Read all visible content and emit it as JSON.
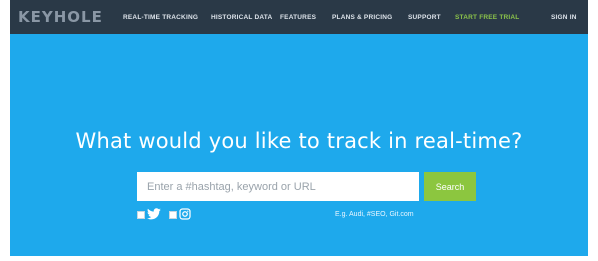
{
  "brand": {
    "logo_text": "KEYHOLE"
  },
  "nav": {
    "items": [
      {
        "label": "REAL-TIME TRACKING"
      },
      {
        "label": "HISTORICAL DATA"
      },
      {
        "label": "FEATURES"
      },
      {
        "label": "PLANS & PRICING"
      },
      {
        "label": "SUPPORT"
      },
      {
        "label": "START FREE TRIAL"
      },
      {
        "label": "SIGN IN"
      }
    ]
  },
  "hero": {
    "headline": "What would you like to track in real-time?",
    "search": {
      "placeholder": "Enter a #hashtag, keyword or URL",
      "value": ""
    },
    "search_button_label": "Search",
    "sources": [
      {
        "name": "twitter",
        "icon": "twitter-icon",
        "checked": true
      },
      {
        "name": "instagram",
        "icon": "instagram-icon",
        "checked": true
      }
    ],
    "example_text": "E.g. Audi, #SEO, Git.com"
  },
  "colors": {
    "hero_bg": "#1ea9ec",
    "nav_bg": "#2a3947",
    "accent_green": "#8cc63f"
  }
}
